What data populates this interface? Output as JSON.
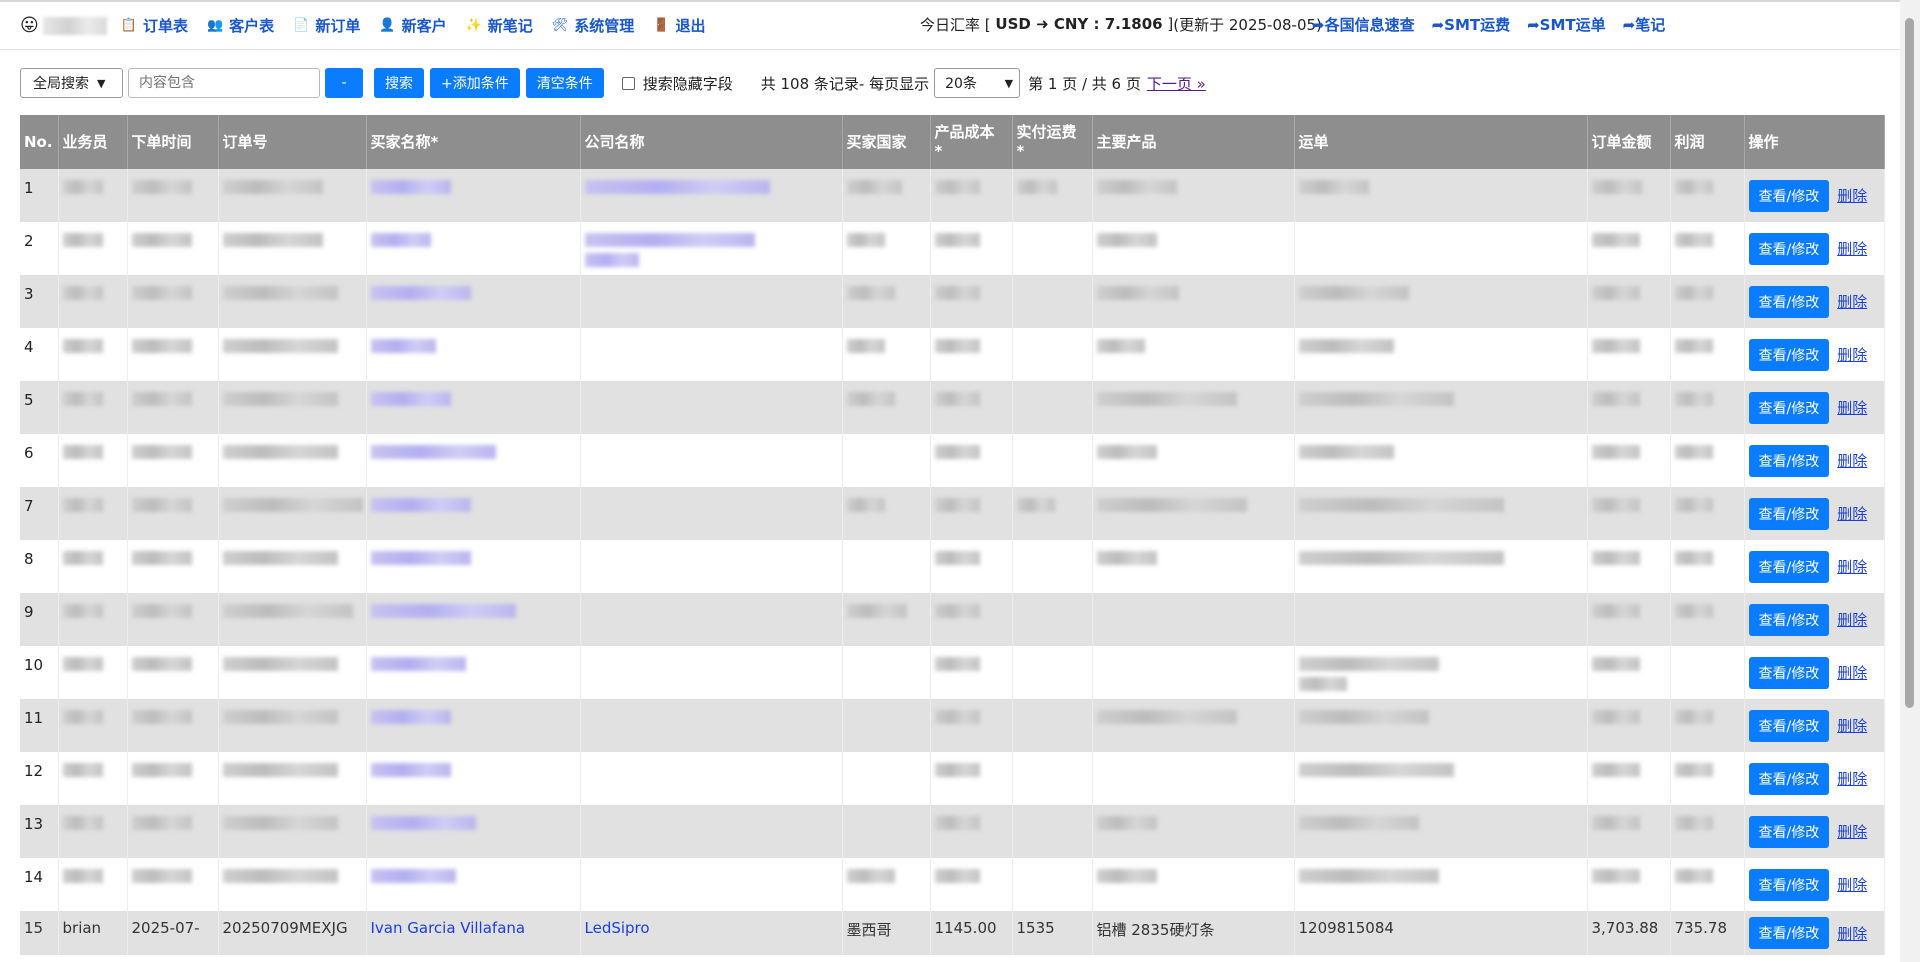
{
  "app": {
    "nav": [
      {
        "label": "订单表",
        "icon": "📋"
      },
      {
        "label": "客户表",
        "icon": "👥"
      },
      {
        "label": "新订单",
        "icon": "📄"
      },
      {
        "label": "新客户",
        "icon": "👤"
      },
      {
        "label": "新笔记",
        "icon": "✨"
      },
      {
        "label": "系统管理",
        "icon": "🛠"
      },
      {
        "label": "退出",
        "icon": "🚪"
      }
    ],
    "rate": {
      "prefix": "今日汇率 [",
      "pair": "USD ➜ CNY : 7.1806",
      "suffix": "]",
      "updated": "(更新于 2025-08-05)"
    },
    "quick_links": [
      "➦各国信息速查",
      "➦SMT运费",
      "➦SMT运单",
      "➦笔记"
    ]
  },
  "search": {
    "scope": "全局搜索",
    "placeholder": "内容包含",
    "minus_label": "-",
    "search_label": "搜索",
    "add_label": "+添加条件",
    "clear_label": "清空条件",
    "hidden_fields_label": "搜索隐藏字段",
    "summary": "共 108 条记录- 每页显示",
    "page_size": "20条",
    "page_info": "第 1 页 / 共 6 页",
    "next_label": "下一页 »"
  },
  "table": {
    "headers": [
      "No.",
      "业务员",
      "下单时间",
      "订单号",
      "买家名称*",
      "公司名称",
      "买家国家",
      "产品成本 *",
      "实付运费 *",
      "主要产品",
      "运单",
      "订单金额",
      "利润",
      "操作"
    ],
    "view_label": "查看/修改",
    "delete_label": "删除",
    "row_numbers": [
      "1",
      "2",
      "3",
      "4",
      "5",
      "6",
      "7",
      "8",
      "9",
      "10",
      "11",
      "12",
      "13",
      "14"
    ],
    "last_row": {
      "no": "15",
      "salesperson": "brian",
      "date": "2025-07-",
      "order_no": "20250709MEXJG",
      "buyer": "Ivan Garcia Villafana",
      "company": "LedSipro",
      "country": "墨西哥",
      "cost": "1145.00",
      "shipping": "1535",
      "product": "铝槽 2835硬灯条",
      "waybill": "1209815084",
      "amount": "3,703.88",
      "profit": "735.78"
    }
  }
}
